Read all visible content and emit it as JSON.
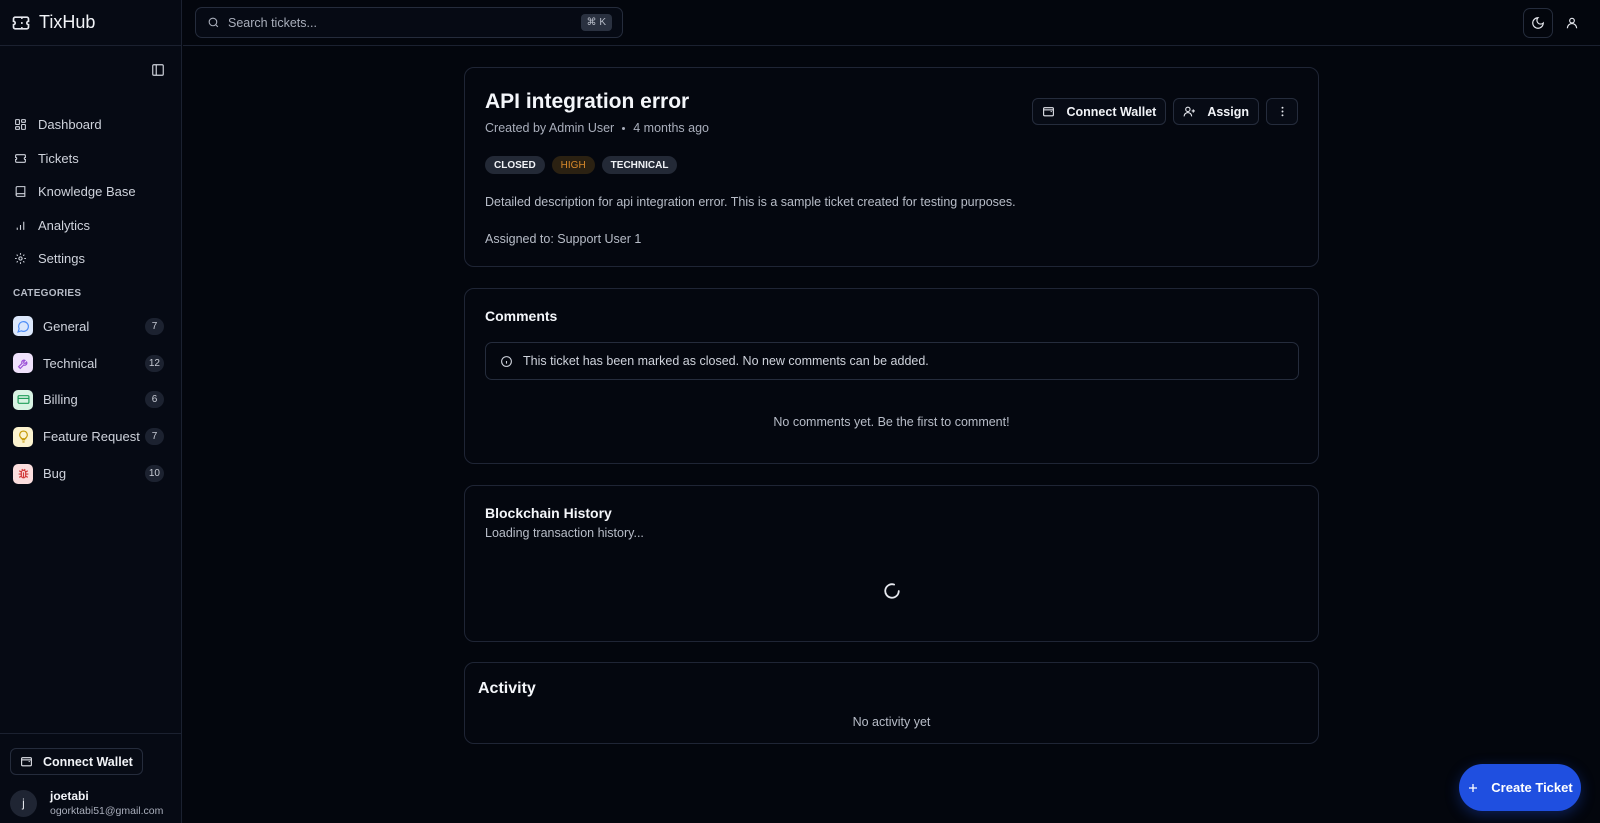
{
  "brand": {
    "name": "TixHub"
  },
  "sidebar": {
    "nav": [
      {
        "label": "Dashboard",
        "icon": "dashboard-icon"
      },
      {
        "label": "Tickets",
        "icon": "ticket-icon"
      },
      {
        "label": "Knowledge Base",
        "icon": "book-icon"
      },
      {
        "label": "Analytics",
        "icon": "bar-chart-icon"
      },
      {
        "label": "Settings",
        "icon": "gear-icon"
      }
    ],
    "categories_title": "CATEGORIES",
    "categories": [
      {
        "label": "General",
        "count": "7",
        "icon": "message-icon",
        "color": "#4f8ef7",
        "bg": "#dbe7fb"
      },
      {
        "label": "Technical",
        "count": "12",
        "icon": "wrench-icon",
        "color": "#9b4fd6",
        "bg": "#efe2fb"
      },
      {
        "label": "Billing",
        "count": "6",
        "icon": "credit-card-icon",
        "color": "#1f9d5a",
        "bg": "#d8f3e3"
      },
      {
        "label": "Feature Request",
        "count": "7",
        "icon": "lightbulb-icon",
        "color": "#c59a0a",
        "bg": "#fbf3cf"
      },
      {
        "label": "Bug",
        "count": "10",
        "icon": "bug-icon",
        "color": "#d23b3b",
        "bg": "#fbdede"
      }
    ],
    "wallet_label": "Connect Wallet",
    "user": {
      "initial": "j",
      "name": "joetabi",
      "email": "ogorktabi51@gmail.com"
    }
  },
  "topbar": {
    "search_placeholder": "Search tickets...",
    "shortcut": "⌘ K"
  },
  "ticket": {
    "title": "API integration error",
    "created_by": "Created by Admin User",
    "time_ago": "4 months ago",
    "connect_wallet_label": "Connect Wallet",
    "assign_label": "Assign",
    "badges": {
      "status": "CLOSED",
      "priority": "HIGH",
      "category": "TECHNICAL"
    },
    "description": "Detailed description for api integration error. This is a sample ticket created for testing purposes.",
    "assigned_to": "Assigned to: Support User 1"
  },
  "comments": {
    "title": "Comments",
    "closed_notice": "This ticket has been marked as closed. No new comments can be added.",
    "empty": "No comments yet. Be the first to comment!"
  },
  "blockchain": {
    "title": "Blockchain History",
    "loading": "Loading transaction history..."
  },
  "activity": {
    "title": "Activity",
    "empty": "No activity yet"
  },
  "fab": {
    "label": "Create Ticket"
  },
  "colors": {
    "accent": "#1f4fe0",
    "priority_high": "#d98a2b",
    "background": "#03060d"
  }
}
